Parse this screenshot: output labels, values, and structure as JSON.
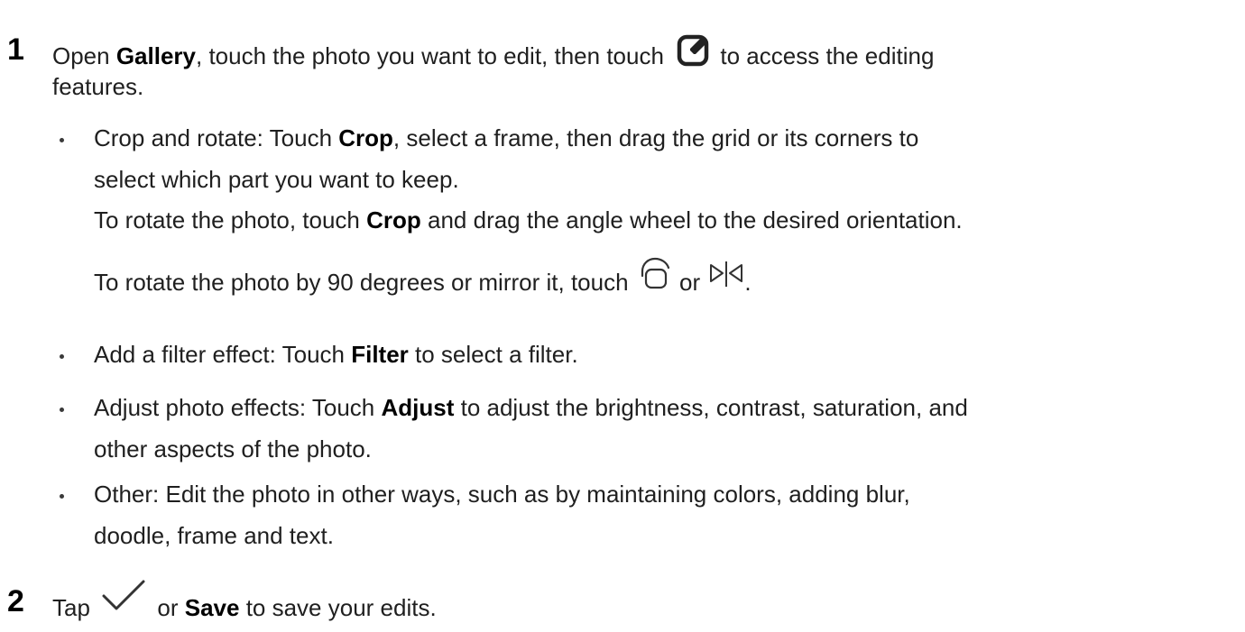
{
  "step1": {
    "number": "1",
    "line1_a": "Open ",
    "line1_b": "Gallery",
    "line1_c": ", touch the photo you want to edit, then touch",
    "line1_d": "to access the editing",
    "line2": "features.",
    "icons": {
      "edit": "edit-square-pencil-icon"
    }
  },
  "bullets": [
    {
      "line1_a": "Crop and rotate: Touch ",
      "line1_b": "Crop",
      "line1_c": ", select a frame, then drag the grid or its corners to",
      "line2": "select which part you want to keep.",
      "line3_a": "To rotate the photo, touch ",
      "line3_b": "Crop",
      "line3_c": " and drag the angle wheel to the desired orientation.",
      "line4_a": "To rotate the photo by 90 degrees or mirror it, touch",
      "line4_b": "or",
      "line4_c": ".",
      "icons": {
        "rotate": "rotate-icon",
        "mirror": "mirror-icon"
      }
    },
    {
      "line1_a": "Add a filter effect: Touch ",
      "line1_b": "Filter",
      "line1_c": " to select a filter."
    },
    {
      "line1_a": "Adjust photo effects: Touch ",
      "line1_b": "Adjust",
      "line1_c": " to adjust the brightness, contrast, saturation, and",
      "line2": "other aspects of the photo."
    },
    {
      "line1": "Other: Edit the photo in other ways, such as by maintaining colors, adding blur,",
      "line2": "doodle, frame and text."
    }
  ],
  "step2": {
    "number": "2",
    "a": "Tap",
    "b": "or ",
    "c": "Save",
    "d": " to save your edits.",
    "icons": {
      "check": "checkmark-icon"
    }
  }
}
